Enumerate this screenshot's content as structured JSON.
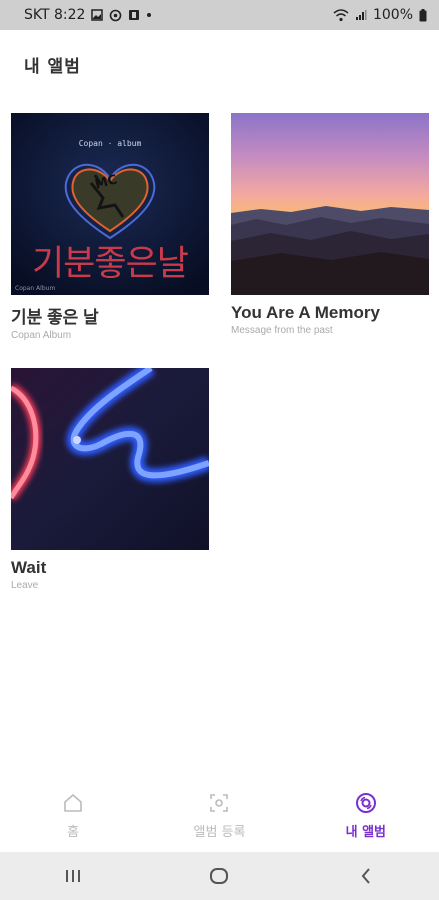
{
  "status_bar": {
    "carrier_time": "SKT 8:22",
    "battery": "100%"
  },
  "header": {
    "title": "내 앨범"
  },
  "albums": [
    {
      "title": "기분 좋은 날",
      "subtitle": "Copan Album",
      "cover_text": "기분좋은날",
      "cover_small_top": "Copan · album",
      "cover_small_bottom": "Copan Album",
      "cover_sticker": "MC"
    },
    {
      "title": "You Are A Memory",
      "subtitle": "Message from the past"
    },
    {
      "title": "Wait",
      "subtitle": "Leave"
    }
  ],
  "bottom_nav": {
    "items": [
      {
        "label": "홈",
        "icon": "home-icon",
        "active": false
      },
      {
        "label": "앨범 등록",
        "icon": "scan-icon",
        "active": false
      },
      {
        "label": "내 앨범",
        "icon": "album-disc-icon",
        "active": true
      }
    ]
  },
  "colors": {
    "accent": "#7a2fd1",
    "inactive": "#bbbbbb",
    "status_bar_bg": "#cfcfcf",
    "system_nav_bg": "#ececec"
  }
}
